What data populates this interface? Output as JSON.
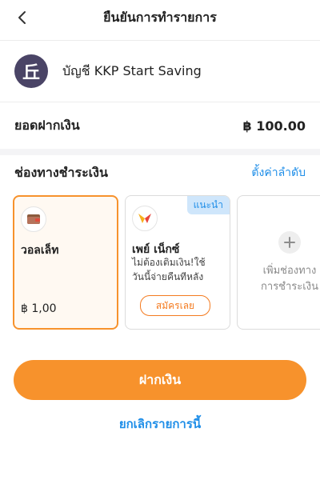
{
  "header": {
    "title": "ยืนยันการทำรายการ",
    "back_icon": "chevron-left-icon"
  },
  "account": {
    "name": "บัญชี KKP Start Saving",
    "logo_glyph": "丘",
    "logo_color": "#4a4466"
  },
  "amount": {
    "label": "ยอดฝากเงิน",
    "value": "฿ 100.00"
  },
  "payment": {
    "title": "ช่องทางชำระเงิน",
    "sort_link": "ตั้งค่าลำดับ",
    "accent": "#f7922c",
    "cards": [
      {
        "name": "วอลเล็ท",
        "balance": "฿ 1,00",
        "icon": "wallet-icon",
        "selected": true
      },
      {
        "name": "เพย์ เน็กซ์",
        "badge": "แนะนำ",
        "desc_line1": "ไม่ต้องเติมเงิน!ใช้",
        "desc_line2": "วันนี้จ่ายคืนทีหลัง",
        "apply_label": "สมัครเลย",
        "icon": "paynext-logo-icon"
      },
      {
        "label_line1": "เพิ่มช่องทาง",
        "label_line2": "การชำระเงิน",
        "icon": "plus-icon"
      }
    ]
  },
  "actions": {
    "primary_label": "ฝากเงิน",
    "cancel_label": "ยกเลิกรายการนี้"
  }
}
